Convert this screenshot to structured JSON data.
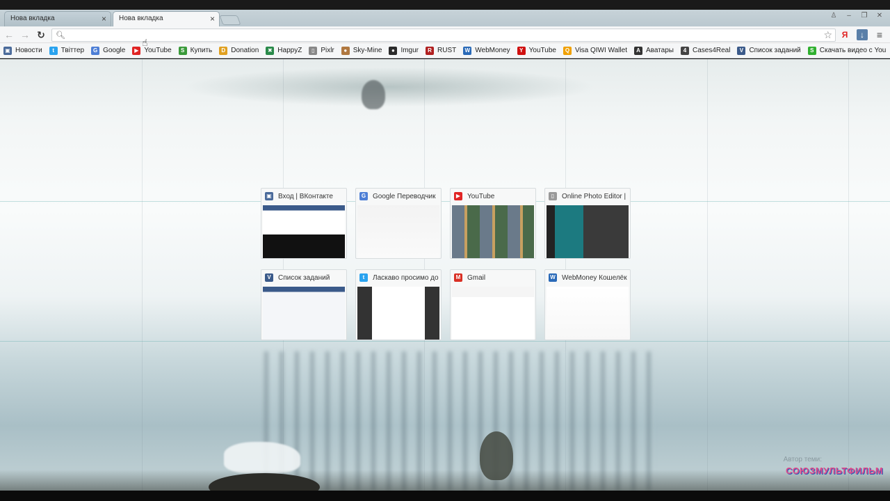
{
  "tabs": [
    {
      "label": "Нова вкладка",
      "active": false
    },
    {
      "label": "Нова вкладка",
      "active": true
    }
  ],
  "omnibox": {
    "value": "",
    "placeholder": ""
  },
  "bookmarks": [
    {
      "label": "Новости",
      "color": "#4a6a9a",
      "glyph": "▣"
    },
    {
      "label": "Твіттер",
      "color": "#2aa3ef",
      "glyph": "t"
    },
    {
      "label": "Google",
      "color": "#4e7fd6",
      "glyph": "G"
    },
    {
      "label": "YouTube",
      "color": "#e02424",
      "glyph": "▶"
    },
    {
      "label": "Купить",
      "color": "#3a9a3a",
      "glyph": "S"
    },
    {
      "label": "Donation",
      "color": "#e0a020",
      "glyph": "D"
    },
    {
      "label": "HappyZ",
      "color": "#2a8a4a",
      "glyph": "✖"
    },
    {
      "label": "Pixlr",
      "color": "#888888",
      "glyph": "▯"
    },
    {
      "label": "Sky-Mine",
      "color": "#b07840",
      "glyph": "●"
    },
    {
      "label": "Imgur",
      "color": "#2b2b2b",
      "glyph": "●"
    },
    {
      "label": "RUST",
      "color": "#b02020",
      "glyph": "R"
    },
    {
      "label": "WebMoney",
      "color": "#2a6ab8",
      "glyph": "W"
    },
    {
      "label": "YouTube",
      "color": "#d01010",
      "glyph": "Y"
    },
    {
      "label": "Visa QIWI Wallet",
      "color": "#f0a000",
      "glyph": "Q"
    },
    {
      "label": "Аватары",
      "color": "#333333",
      "glyph": "A"
    },
    {
      "label": "Cases4Real",
      "color": "#444444",
      "glyph": "4"
    },
    {
      "label": "Список заданий",
      "color": "#3b5a8a",
      "glyph": "V"
    },
    {
      "label": "Скачать видео с You",
      "color": "#30b030",
      "glyph": "S"
    }
  ],
  "speed_dial": [
    {
      "title": "Вход | ВКонтакте",
      "icon_color": "#4a6a9a",
      "glyph": "▣"
    },
    {
      "title": "Google Переводчик",
      "icon_color": "#4e7fd6",
      "glyph": "G"
    },
    {
      "title": "YouTube",
      "icon_color": "#e02424",
      "glyph": "▶"
    },
    {
      "title": "Online Photo Editor |",
      "icon_color": "#999999",
      "glyph": "▯"
    },
    {
      "title": "Список заданий",
      "icon_color": "#3b5a8a",
      "glyph": "V"
    },
    {
      "title": "Ласкаво просимо до",
      "icon_color": "#2aa3ef",
      "glyph": "t"
    },
    {
      "title": "Gmail",
      "icon_color": "#d93025",
      "glyph": "M"
    },
    {
      "title": "WebMoney Кошелёк",
      "icon_color": "#2a6ab8",
      "glyph": "W"
    }
  ],
  "theme": {
    "author_label": "Автор теми:",
    "logo_text": "СОЮЗМУЛЬТФИЛЬМ"
  }
}
